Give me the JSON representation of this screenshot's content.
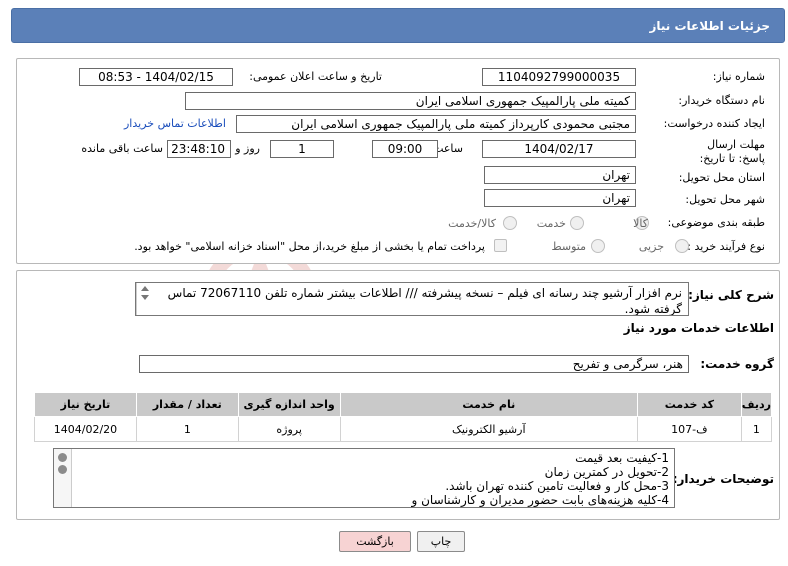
{
  "title": "جزئیات اطلاعات نیاز",
  "fields": {
    "need_number": {
      "label": "شماره نیاز:",
      "value": "1104092799000035"
    },
    "announce": {
      "label": "تاریخ و ساعت اعلان عمومی:",
      "value": "1404/02/15 - 08:53"
    },
    "buyer_org": {
      "label": "نام دستگاه خریدار:",
      "value": "کمیته ملی پارالمپیک جمهوری اسلامی ایران"
    },
    "requester": {
      "label": "ایجاد کننده درخواست:",
      "value": "مجتبی محمودی کارپرداز کمیته ملی پارالمپیک جمهوری اسلامی ایران"
    },
    "contact_link": "اطلاعات تماس خریدار",
    "deadline": {
      "label": "مهلت ارسال پاسخ: تا تاریخ:",
      "date": "1404/02/17",
      "time_label": "ساعت",
      "time": "09:00",
      "days": "1",
      "days_label": "روز و",
      "remaining": "23:48:10",
      "remaining_label": "ساعت باقی مانده"
    },
    "province": {
      "label": "استان محل تحویل:",
      "value": "تهران"
    },
    "city": {
      "label": "شهر محل تحویل:",
      "value": "تهران"
    },
    "category": {
      "label": "طبقه بندی موضوعی:",
      "options": [
        "کالا",
        "خدمت",
        "کالا/خدمت"
      ]
    },
    "process": {
      "label": "نوع فرآیند خرید :",
      "options": [
        "جزیی",
        "متوسط"
      ],
      "note": "پرداخت تمام یا بخشی از مبلغ خرید،از محل \"اسناد خزانه اسلامی\" خواهد بود."
    }
  },
  "summary": {
    "label": "شرح کلی نیاز:",
    "text": "نرم افزار آرشیو چند رسانه ای فیلم – نسخه پیشرفته /// اطلاعات بیشتر شماره تلفن 72067110 تماس گرفته شود."
  },
  "services": {
    "section_title": "اطلاعات خدمات مورد نیاز",
    "group_label": "گروه خدمت:",
    "group_value": "هنر، سرگرمی و تفریح",
    "columns": [
      "ردیف",
      "کد خدمت",
      "نام خدمت",
      "واحد اندازه گیری",
      "تعداد / مقدار",
      "تاریخ نیاز"
    ],
    "rows": [
      [
        "1",
        "ف-107",
        "آرشیو الکترونیک",
        "پروژه",
        "1",
        "1404/02/20"
      ]
    ]
  },
  "buyer_notes": {
    "label": "توضیحات خریدار:",
    "lines": [
      "1-کیفیت بعد قیمت",
      "2-تحویل در کمترین زمان",
      "3-محل کار و فعالیت تامین کننده تهران باشد.",
      "4-کلیه هزینه‌های بابت حضور مدیران و کارشناسان و"
    ]
  },
  "buttons": {
    "print": "چاپ",
    "back": "بازگشت"
  },
  "watermark": "AriaTender.neT",
  "colors": {
    "title_bar": "#5b80b8",
    "link": "#1a4dbb",
    "back_button": "#f7d3d3"
  }
}
